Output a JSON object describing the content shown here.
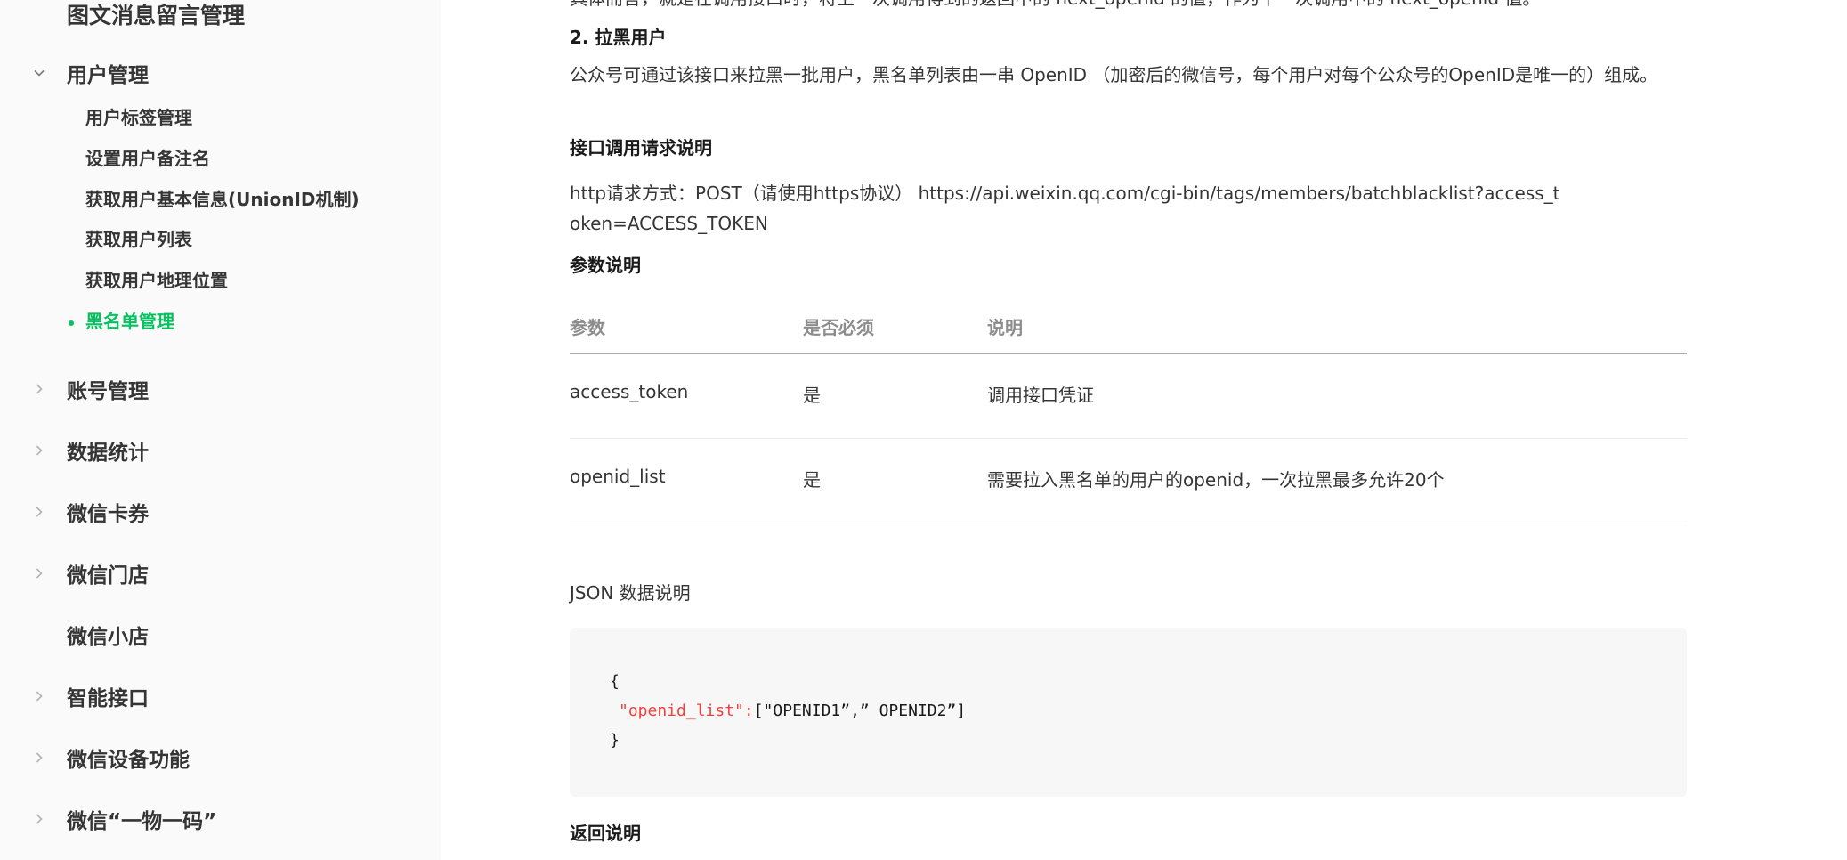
{
  "sidebar": {
    "top_item": "图文消息留言管理",
    "user_group": {
      "label": "用户管理",
      "items": [
        "用户标签管理",
        "设置用户备注名",
        "获取用户基本信息(UnionID机制)",
        "获取用户列表",
        "获取用户地理位置",
        "黑名单管理"
      ]
    },
    "groups": [
      "账号管理",
      "数据统计",
      "微信卡券",
      "微信门店",
      "微信小店",
      "智能接口",
      "微信设备功能",
      "微信“一物一码”"
    ]
  },
  "content": {
    "top_faded": "具体而言，就是在调用接口时，将上一次调用得到的返回中的 next_openid 的值，作为下一次调用中的 next_openid 值。",
    "section_title": "2. 拉黑用户",
    "intro": "公众号可通过该接口来拉黑一批用户，黑名单列表由一串 OpenID （加密后的微信号，每个用户对每个公众号的OpenID是唯一的）组成。",
    "request_title": "接口调用请求说明",
    "request_text": "http请求方式：POST（请使用https协议） https://api.weixin.qq.com/cgi-bin/tags/members/batchblacklist?access_token=ACCESS_TOKEN",
    "params_title": "参数说明",
    "table": {
      "headers": [
        "参数",
        "是否必须",
        "说明"
      ],
      "rows": [
        [
          "access_token",
          "是",
          "调用接口凭证"
        ],
        [
          "openid_list",
          "是",
          "需要拉入黑名单的用户的openid，一次拉黑最多允许20个"
        ]
      ]
    },
    "json_title": "JSON 数据说明",
    "code": {
      "open": "{",
      "key": "\"openid_list\":",
      "value": "[\"OPENID1”,” OPENID2”]",
      "close": "}"
    },
    "return_title": "返回说明"
  },
  "colors": {
    "accent": "#07c160",
    "code_key": "#f1403c"
  }
}
